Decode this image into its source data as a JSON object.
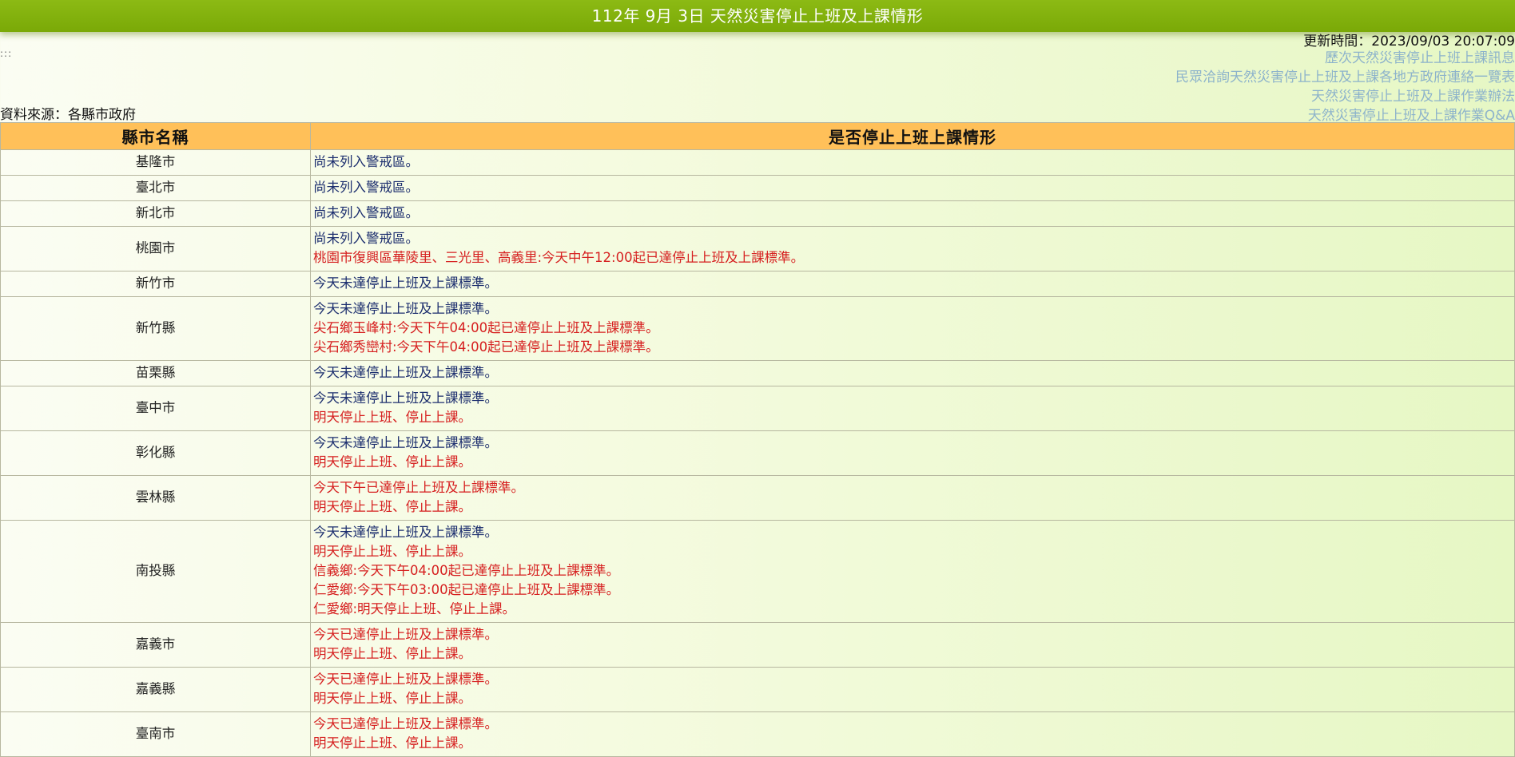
{
  "header": {
    "title": "112年 9月 3日 天然災害停止上班及上課情形"
  },
  "dots": ":::",
  "update_time": "更新時間：2023/09/03 20:07:09",
  "links": [
    "歷次天然災害停止上班上課訊息",
    "民眾洽詢天然災害停止上班及上課各地方政府連絡一覽表",
    "天然災害停止上班及上課作業辦法",
    "天然災害停止上班及上課作業Q&A"
  ],
  "source": "資料來源：各縣市政府",
  "table": {
    "headers": [
      "縣市名稱",
      "是否停止上班上課情形"
    ],
    "rows": [
      {
        "city": "基隆市",
        "lines": [
          {
            "text": "尚未列入警戒區。",
            "alert": false
          }
        ]
      },
      {
        "city": "臺北市",
        "lines": [
          {
            "text": "尚未列入警戒區。",
            "alert": false
          }
        ]
      },
      {
        "city": "新北市",
        "lines": [
          {
            "text": "尚未列入警戒區。",
            "alert": false
          }
        ]
      },
      {
        "city": "桃園市",
        "lines": [
          {
            "text": "尚未列入警戒區。",
            "alert": false
          },
          {
            "text": "桃園市復興區華陵里、三光里、高義里:今天中午12:00起已達停止上班及上課標準。",
            "alert": true
          }
        ]
      },
      {
        "city": "新竹市",
        "lines": [
          {
            "text": "今天未達停止上班及上課標準。",
            "alert": false
          }
        ]
      },
      {
        "city": "新竹縣",
        "lines": [
          {
            "text": "今天未達停止上班及上課標準。",
            "alert": false
          },
          {
            "text": "尖石鄉玉峰村:今天下午04:00起已達停止上班及上課標準。",
            "alert": true
          },
          {
            "text": "尖石鄉秀巒村:今天下午04:00起已達停止上班及上課標準。",
            "alert": true
          }
        ]
      },
      {
        "city": "苗栗縣",
        "lines": [
          {
            "text": "今天未達停止上班及上課標準。",
            "alert": false
          }
        ]
      },
      {
        "city": "臺中市",
        "lines": [
          {
            "text": "今天未達停止上班及上課標準。",
            "alert": false
          },
          {
            "text": "明天停止上班、停止上課。",
            "alert": true
          }
        ]
      },
      {
        "city": "彰化縣",
        "lines": [
          {
            "text": "今天未達停止上班及上課標準。",
            "alert": false
          },
          {
            "text": "明天停止上班、停止上課。",
            "alert": true
          }
        ]
      },
      {
        "city": "雲林縣",
        "lines": [
          {
            "text": "今天下午已達停止上班及上課標準。",
            "alert": true
          },
          {
            "text": "明天停止上班、停止上課。",
            "alert": true
          }
        ]
      },
      {
        "city": "南投縣",
        "lines": [
          {
            "text": "今天未達停止上班及上課標準。",
            "alert": false
          },
          {
            "text": "明天停止上班、停止上課。",
            "alert": true
          },
          {
            "text": "信義鄉:今天下午04:00起已達停止上班及上課標準。",
            "alert": true
          },
          {
            "text": "仁愛鄉:今天下午03:00起已達停止上班及上課標準。",
            "alert": true
          },
          {
            "text": "仁愛鄉:明天停止上班、停止上課。",
            "alert": true
          }
        ]
      },
      {
        "city": "嘉義市",
        "lines": [
          {
            "text": "今天已達停止上班及上課標準。",
            "alert": true
          },
          {
            "text": "明天停止上班、停止上課。",
            "alert": true
          }
        ]
      },
      {
        "city": "嘉義縣",
        "lines": [
          {
            "text": "今天已達停止上班及上課標準。",
            "alert": true
          },
          {
            "text": "明天停止上班、停止上課。",
            "alert": true
          }
        ]
      },
      {
        "city": "臺南市",
        "lines": [
          {
            "text": "今天已達停止上班及上課標準。",
            "alert": true
          },
          {
            "text": "明天停止上班、停止上課。",
            "alert": true
          }
        ]
      }
    ]
  },
  "colors": {
    "title_bar": "#7aa907",
    "header_bg": "#ffc059",
    "normal_text": "#1c2e6e",
    "alert_text": "#d62020",
    "link": "#8db3cb"
  }
}
